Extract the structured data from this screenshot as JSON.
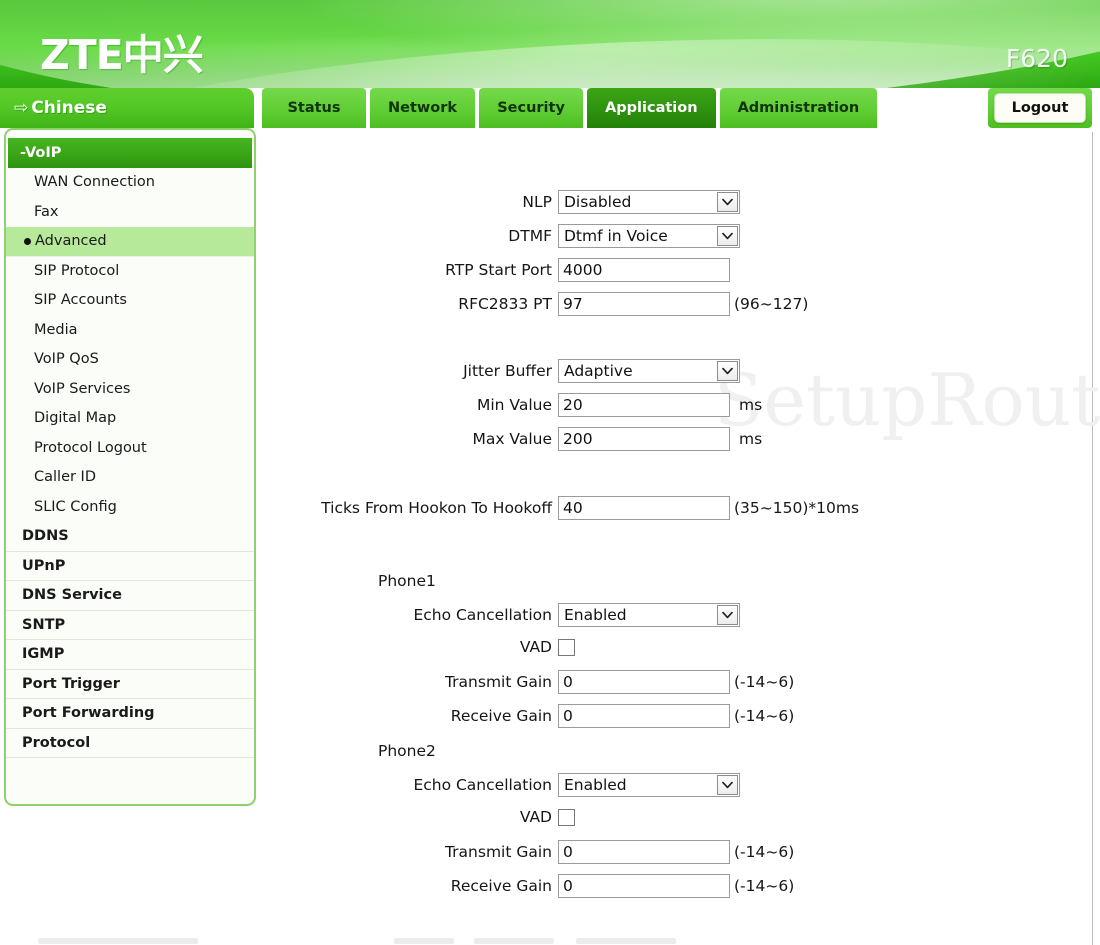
{
  "header": {
    "logo_text": "ZTE中兴",
    "model": "F620"
  },
  "nav": {
    "language_arrow": "⇨",
    "language_label": "Chinese",
    "tabs": [
      {
        "label": "Status",
        "active": false
      },
      {
        "label": "Network",
        "active": false
      },
      {
        "label": "Security",
        "active": false
      },
      {
        "label": "Application",
        "active": true
      },
      {
        "label": "Administration",
        "active": false
      }
    ],
    "logout_label": "Logout"
  },
  "sidebar": {
    "header_label": "-VoIP",
    "items": [
      {
        "label": "WAN Connection",
        "type": "plain",
        "selected": false
      },
      {
        "label": "Fax",
        "type": "plain",
        "selected": false
      },
      {
        "label": "Advanced",
        "type": "plain",
        "selected": true
      },
      {
        "label": "SIP Protocol",
        "type": "plain",
        "selected": false
      },
      {
        "label": "SIP Accounts",
        "type": "plain",
        "selected": false
      },
      {
        "label": "Media",
        "type": "plain",
        "selected": false
      },
      {
        "label": "VoIP QoS",
        "type": "plain",
        "selected": false
      },
      {
        "label": "VoIP Services",
        "type": "plain",
        "selected": false
      },
      {
        "label": "Digital Map",
        "type": "plain",
        "selected": false
      },
      {
        "label": "Protocol Logout",
        "type": "plain",
        "selected": false
      },
      {
        "label": "Caller ID",
        "type": "plain",
        "selected": false
      },
      {
        "label": "SLIC Config",
        "type": "plain",
        "selected": false
      },
      {
        "label": "DDNS",
        "type": "group",
        "selected": false
      },
      {
        "label": "UPnP",
        "type": "group",
        "selected": false
      },
      {
        "label": "DNS Service",
        "type": "group",
        "selected": false
      },
      {
        "label": "SNTP",
        "type": "group",
        "selected": false
      },
      {
        "label": "IGMP",
        "type": "group",
        "selected": false
      },
      {
        "label": "Port Trigger",
        "type": "group",
        "selected": false
      },
      {
        "label": "Port Forwarding",
        "type": "group",
        "selected": false
      },
      {
        "label": "Protocol",
        "type": "group",
        "selected": false
      }
    ]
  },
  "watermark": {
    "text": "SetupRouter.co"
  },
  "form": {
    "nlp": {
      "label": "NLP",
      "value": "Disabled"
    },
    "dtmf": {
      "label": "DTMF",
      "value": "Dtmf in Voice"
    },
    "rtp_start_port": {
      "label": "RTP Start Port",
      "value": "4000"
    },
    "rfc2833_pt": {
      "label": "RFC2833 PT",
      "value": "97",
      "hint": "(96~127)"
    },
    "jitter_buffer": {
      "label": "Jitter Buffer",
      "value": "Adaptive"
    },
    "min_value": {
      "label": "Min Value",
      "value": "20",
      "unit": "ms"
    },
    "max_value": {
      "label": "Max Value",
      "value": "200",
      "unit": "ms"
    },
    "ticks": {
      "label": "Ticks From Hookon To Hookoff",
      "value": "40",
      "hint": "(35~150)*10ms"
    },
    "phone1": {
      "title": "Phone1",
      "echo_cancellation": {
        "label": "Echo Cancellation",
        "value": "Enabled"
      },
      "vad": {
        "label": "VAD",
        "checked": false
      },
      "transmit_gain": {
        "label": "Transmit Gain",
        "value": "0",
        "hint": "(-14~6)"
      },
      "receive_gain": {
        "label": "Receive Gain",
        "value": "0",
        "hint": "(-14~6)"
      }
    },
    "phone2": {
      "title": "Phone2",
      "echo_cancellation": {
        "label": "Echo Cancellation",
        "value": "Enabled"
      },
      "vad": {
        "label": "VAD",
        "checked": false
      },
      "transmit_gain": {
        "label": "Transmit Gain",
        "value": "0",
        "hint": "(-14~6)"
      },
      "receive_gain": {
        "label": "Receive Gain",
        "value": "0",
        "hint": "(-14~6)"
      }
    }
  },
  "colors": {
    "brand_green": "#3cc01c",
    "tab_active": "#2f9410",
    "sidebar_selected": "#b7e99a",
    "sidebar_border": "#8fd16d"
  }
}
